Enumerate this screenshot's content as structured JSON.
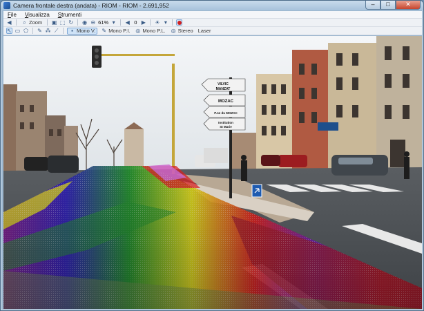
{
  "window": {
    "title": "Camera frontale destra (andata) - RIOM - RIOM - 2.691,952",
    "minimize": "–",
    "maximize": "□",
    "close": "✕"
  },
  "menu": [
    {
      "label": "File"
    },
    {
      "label": "Visualizza"
    },
    {
      "label": "Strumenti"
    }
  ],
  "toolbar": {
    "zoom_label": "Zoom",
    "zoom_value": "61%",
    "frame_counter": "0"
  },
  "mode_toolbar": {
    "modes": [
      {
        "label": "Mono V.",
        "active": true
      },
      {
        "label": "Mono P.I.",
        "active": false
      },
      {
        "label": "Mono P.L.",
        "active": false
      },
      {
        "label": "Stereo",
        "active": false
      },
      {
        "label": "Laser",
        "active": false
      }
    ]
  },
  "scene": {
    "signs": [
      "VILVIC",
      "MANZAT",
      "MOZAC",
      "P.ne du MOZAC",
      "Institution",
      "St Marie"
    ]
  },
  "colors": {
    "accent": "#cfe3f7",
    "record": "#d02020",
    "titlebar": "#a7c2db"
  }
}
